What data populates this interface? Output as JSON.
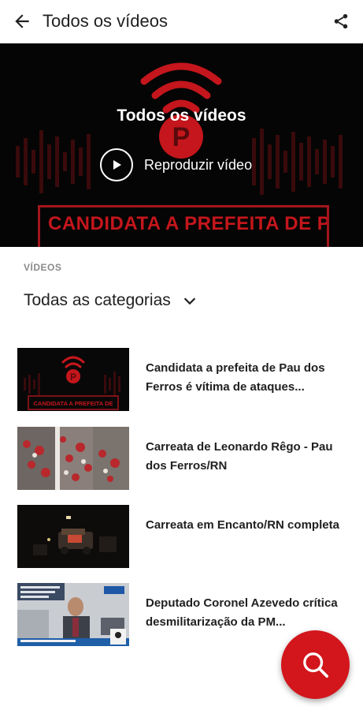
{
  "app_bar": {
    "title": "Todos os vídeos",
    "back_icon": "arrow-left-icon",
    "share_icon": "share-icon"
  },
  "hero": {
    "title": "Todos os vídeos",
    "play_label": "Reproduzir vídeo",
    "headline_text": "CANDIDATA A PREFEITA DE PAU DOS FERROS É VÍTIMA",
    "logo_letter": "P",
    "brand_color": "#c4161c"
  },
  "section": {
    "label": "VÍDEOS",
    "category": "Todas as categorias"
  },
  "videos": [
    {
      "title": "Candidata a prefeita de Pau dos Ferros é vítima de ataques...",
      "thumb_caption": "CANDIDATA A PREFEITA DE",
      "logo_letter": "P"
    },
    {
      "title": "Carreata de Leonardo Rêgo - Pau dos Ferros/RN"
    },
    {
      "title": "Carreata em Encanto/RN completa"
    },
    {
      "title": "Deputado Coronel Azevedo crítica desmilitarização da PM..."
    }
  ],
  "fab": {
    "icon": "search-icon",
    "color": "#d2161c"
  }
}
